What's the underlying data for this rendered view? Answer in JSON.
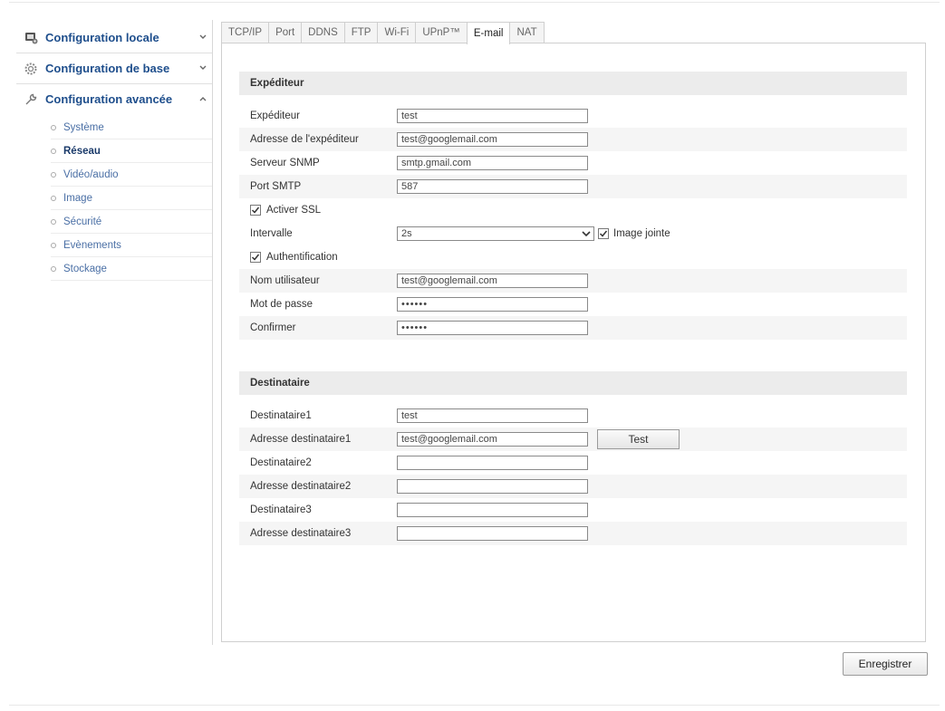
{
  "sidebar": {
    "sections": [
      {
        "label": "Configuration locale",
        "icon": "monitor-settings-icon",
        "caret": "chevron-down-icon"
      },
      {
        "label": "Configuration de base",
        "icon": "gear-icon",
        "caret": "chevron-down-icon"
      },
      {
        "label": "Configuration avancée",
        "icon": "wrench-icon",
        "caret": "chevron-up-icon"
      }
    ],
    "subitems": [
      {
        "label": "Système"
      },
      {
        "label": "Réseau",
        "active": true
      },
      {
        "label": "Vidéo/audio"
      },
      {
        "label": "Image"
      },
      {
        "label": "Sécurité"
      },
      {
        "label": "Evènements"
      },
      {
        "label": "Stockage"
      }
    ]
  },
  "tabs": [
    {
      "label": "TCP/IP"
    },
    {
      "label": "Port"
    },
    {
      "label": "DDNS"
    },
    {
      "label": "FTP"
    },
    {
      "label": "Wi-Fi"
    },
    {
      "label": "UPnP™"
    },
    {
      "label": "E-mail",
      "active": true
    },
    {
      "label": "NAT"
    }
  ],
  "sender": {
    "title": "Expéditeur",
    "sender_label": "Expéditeur",
    "sender_value": "test",
    "address_label": "Adresse de l'expéditeur",
    "address_value": "test@googlemail.com",
    "server_label": "Serveur SNMP",
    "server_value": "smtp.gmail.com",
    "port_label": "Port SMTP",
    "port_value": "587",
    "ssl_label": "Activer SSL",
    "ssl_checked": true,
    "interval_label": "Intervalle",
    "interval_value": "2s",
    "attach_label": "Image jointe",
    "attach_checked": true,
    "auth_label": "Authentification",
    "auth_checked": true,
    "user_label": "Nom utilisateur",
    "user_value": "test@googlemail.com",
    "password_label": "Mot de passe",
    "password_value": "••••••",
    "confirm_label": "Confirmer",
    "confirm_value": "••••••"
  },
  "recipient": {
    "title": "Destinataire",
    "r1_label": "Destinataire1",
    "r1_value": "test",
    "a1_label": "Adresse destinataire1",
    "a1_value": "test@googlemail.com",
    "test_label": "Test",
    "r2_label": "Destinataire2",
    "r2_value": "",
    "a2_label": "Adresse destinataire2",
    "a2_value": "",
    "r3_label": "Destinataire3",
    "r3_value": "",
    "a3_label": "Adresse destinataire3",
    "a3_value": ""
  },
  "footer": {
    "save_label": "Enregistrer"
  }
}
